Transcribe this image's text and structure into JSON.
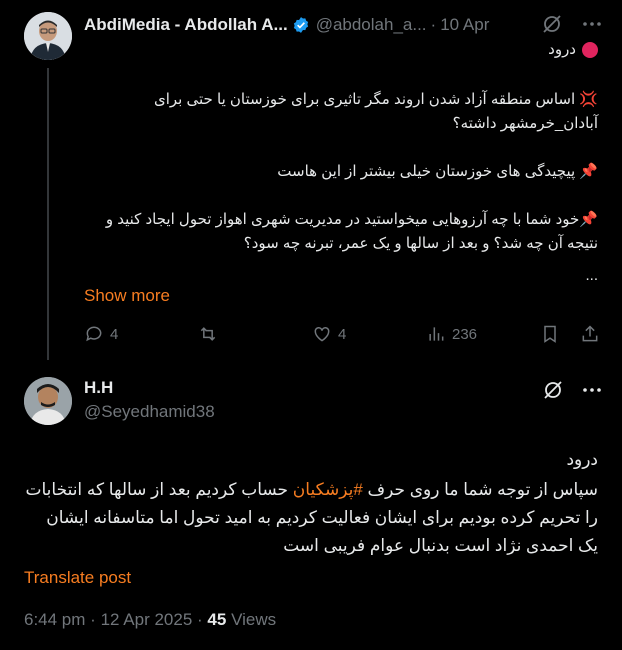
{
  "original_post": {
    "author_name": "AbdiMedia - Abdollah A...",
    "handle": "@abdolah_a...",
    "separator": "·",
    "date": "10 Apr",
    "line1": "درود",
    "para1": "💢 اساس منطقه آزاد شدن اروند مگر تاثیری برای خوزستان یا حتی برای آبادان_خرمشهر داشته؟",
    "para2": "📌 پیچیدگی های خوزستان خیلی بیشتر از این هاست",
    "para3": "📌خود شما با چه آرزوهایی میخواستید در مدیریت شهری اهواز تحول ایجاد کنید و نتیجه آن چه شد؟ و بعد از سالها و یک عمر، تبرنه چه سود؟",
    "ellipsis": "...",
    "show_more": "Show more",
    "replies_count": "4",
    "likes_count": "4",
    "views_count": "236"
  },
  "reply_post": {
    "author_name": "H.H",
    "handle": "@Seyedhamid38",
    "line1": "درود",
    "text_before_hashtag": "سپاس از توجه شما  ما روی حرف ",
    "hashtag": "#پزشکیان",
    "text_after_hashtag": " حساب کردیم بعد از سالها که انتخابات را تحریم کرده بودیم برای ایشان فعالیت کردیم به امید تحول اما متاسفانه ایشان   یک احمدی نژاد است بدنبال عوام فریبی است",
    "translate_label": "Translate post",
    "time": "6:44 pm",
    "separator": "·",
    "date": "12 Apr 2025",
    "views_number": "45",
    "views_label": "Views"
  },
  "colors": {
    "background": "#000000",
    "accent": "#f77d21",
    "muted": "#71767b",
    "verified": "#1d9bf0"
  },
  "icons": [
    "verified-badge-icon",
    "grok-icon",
    "more-icon",
    "reply-icon",
    "retweet-icon",
    "like-icon",
    "views-icon",
    "bookmark-icon",
    "share-icon"
  ]
}
